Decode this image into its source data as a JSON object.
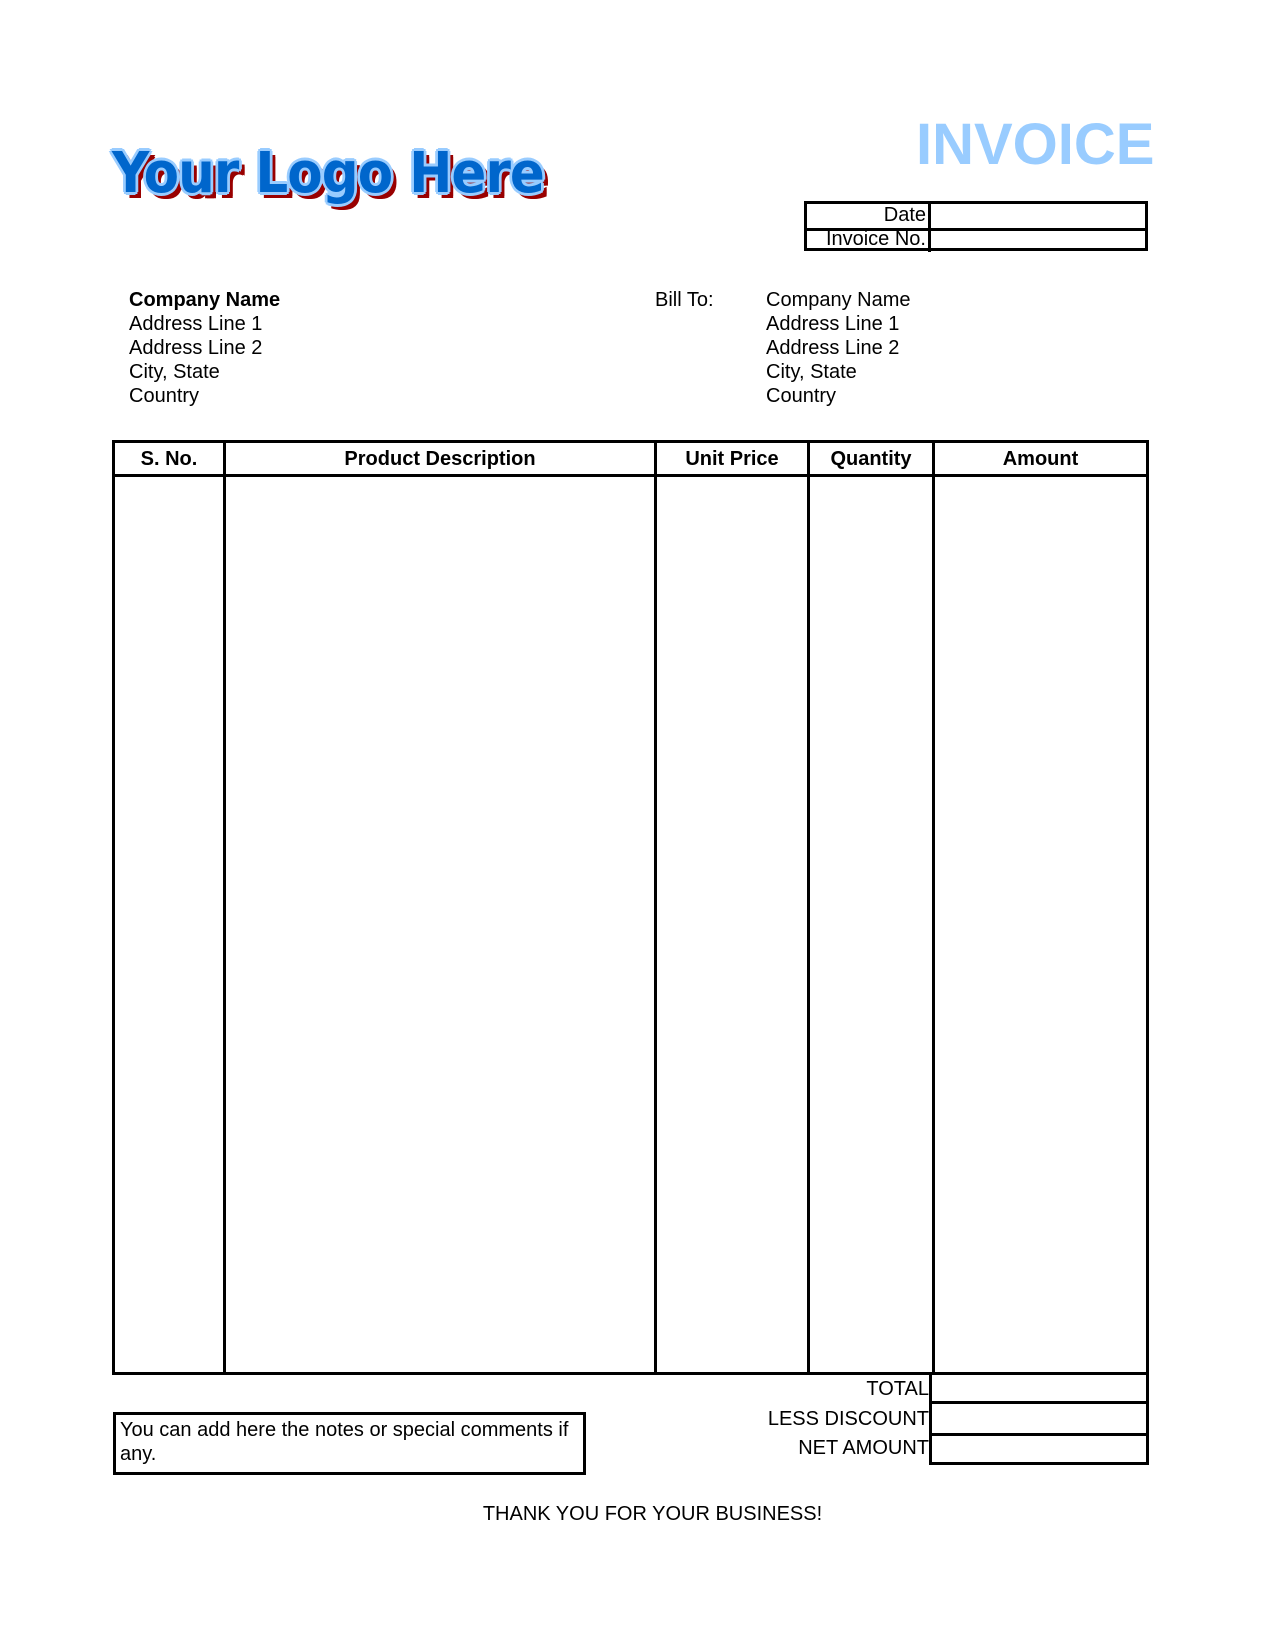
{
  "logo": {
    "text": "Your Logo Here",
    "colors": {
      "fill": "#0066cc",
      "outline": "#99ccff",
      "shadow": "#990000"
    }
  },
  "title": {
    "text": "INVOICE",
    "color": "#99ccff"
  },
  "meta": {
    "date_label": "Date",
    "date_value": "",
    "invoice_no_label": "Invoice No.",
    "invoice_no_value": ""
  },
  "from": {
    "company": "Company Name",
    "lines": [
      "Address Line 1",
      "Address Line 2",
      "City, State",
      "Country"
    ]
  },
  "bill_to": {
    "label": "Bill To:",
    "company": "Company Name",
    "lines": [
      "Address Line 1",
      "Address Line 2",
      "City, State",
      "Country"
    ]
  },
  "items_table": {
    "columns": [
      "S. No.",
      "Product Description",
      "Unit Price",
      "Quantity",
      "Amount"
    ],
    "rows": []
  },
  "totals": {
    "total_label": "TOTAL",
    "total_value": "",
    "discount_label": "LESS DISCOUNT",
    "discount_value": "",
    "net_label": "NET AMOUNT",
    "net_value": ""
  },
  "notes": "You can add here the notes or special comments if any.",
  "footer": "THANK YOU FOR YOUR BUSINESS!"
}
